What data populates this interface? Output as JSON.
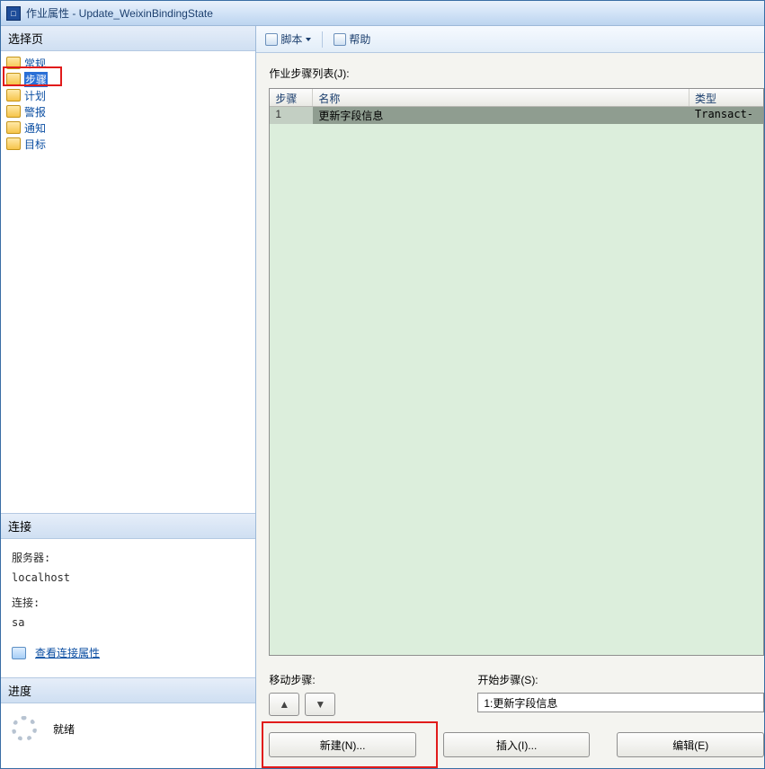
{
  "window": {
    "title": "作业属性 - Update_WeixinBindingState"
  },
  "left": {
    "select_page_header": "选择页",
    "nav_items": [
      {
        "label": "常规",
        "selected": false
      },
      {
        "label": "步骤",
        "selected": true
      },
      {
        "label": "计划",
        "selected": false
      },
      {
        "label": "警报",
        "selected": false
      },
      {
        "label": "通知",
        "selected": false
      },
      {
        "label": "目标",
        "selected": false
      }
    ],
    "connection_header": "连接",
    "server_label": "服务器:",
    "server_value": "localhost",
    "conn_label": "连接:",
    "conn_value": "sa",
    "view_conn_props": "查看连接属性",
    "progress_header": "进度",
    "progress_status": "就绪"
  },
  "toolbar": {
    "script_label": "脚本",
    "help_label": "帮助"
  },
  "main": {
    "list_label": "作业步骤列表(J):",
    "columns": {
      "step": "步骤",
      "name": "名称",
      "type": "类型"
    },
    "rows": [
      {
        "step": "1",
        "name": "更新字段信息",
        "type": "Transact-"
      }
    ],
    "move_step_label": "移动步骤:",
    "start_step_label": "开始步骤(S):",
    "start_step_value": "1:更新字段信息",
    "arrow_up": "▲",
    "arrow_down": "▼",
    "buttons": {
      "new": "新建(N)...",
      "insert": "插入(I)...",
      "edit": "编辑(E)"
    }
  }
}
